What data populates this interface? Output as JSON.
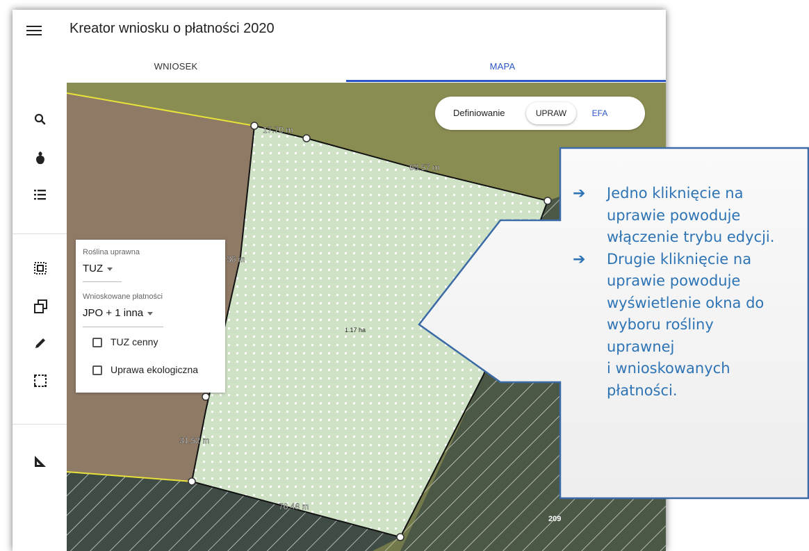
{
  "app": {
    "title": "Kreator wniosku o płatności 2020",
    "accent_color": "#2a56c6"
  },
  "tabs": [
    {
      "label": "WNIOSEK",
      "active": false
    },
    {
      "label": "MAPA",
      "active": true
    }
  ],
  "sidebar": {
    "items": [
      {
        "icon": "search-icon"
      },
      {
        "icon": "crop-plant-icon"
      },
      {
        "icon": "list-icon"
      },
      {
        "icon": "select-area-icon"
      },
      {
        "icon": "copy-icon"
      },
      {
        "icon": "pencil-icon"
      },
      {
        "icon": "dashed-rectangle-icon"
      },
      {
        "icon": "ruler-triangle-icon"
      }
    ]
  },
  "mode_toggle": {
    "label": "Definiowanie",
    "options": [
      "UPRAW",
      "EFA"
    ],
    "selected": "UPRAW"
  },
  "map": {
    "measurements": [
      "17.70 m",
      "68.57 m",
      "36 m",
      "31.52 m",
      "76.48 m"
    ],
    "area_label": "1.17 ha",
    "parcel_number": "209"
  },
  "crop_popup": {
    "crop_label": "Roślina uprawna",
    "crop_value": "TUZ",
    "payments_label": "Wnioskowane płatności",
    "payments_value": "JPO + 1 inna",
    "checkboxes": [
      {
        "label": "TUZ cenny",
        "checked": false
      },
      {
        "label": "Uprawa ekologiczna",
        "checked": false
      }
    ]
  },
  "callout": {
    "color": "#2e74b5",
    "items": [
      "Jedno kliknięcie na uprawie powoduje włączenie trybu edycji.",
      "Drugie kliknięcie na uprawie powoduje wyświetlenie okna do wyboru rośliny uprawnej i wnioskowanych płatności."
    ],
    "lines": [
      [
        "Jedno kliknięcie na",
        "uprawie powoduje",
        "włączenie trybu edycji."
      ],
      [
        "Drugie kliknięcie na",
        "uprawie powoduje",
        "wyświetlenie okna do",
        "wyboru rośliny",
        "uprawnej",
        "i wnioskowanych",
        "płatności."
      ]
    ]
  }
}
